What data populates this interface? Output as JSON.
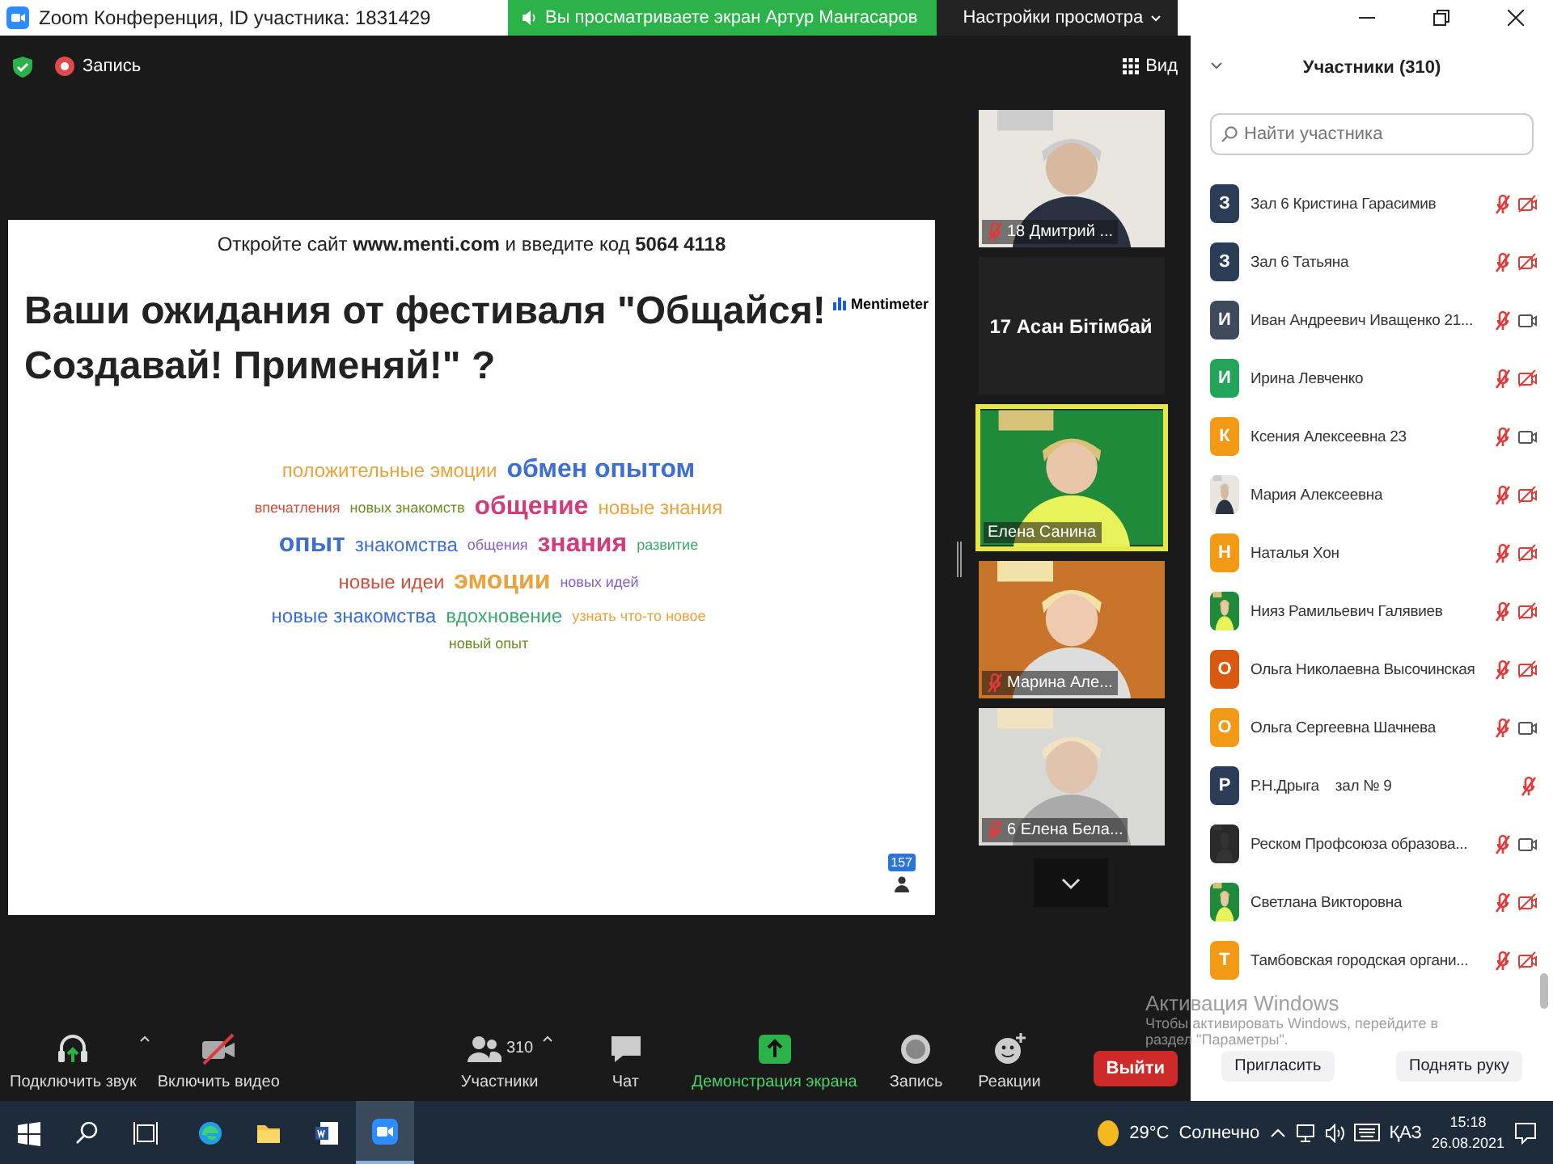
{
  "title_bar": {
    "title": "Zoom Конференция, ID участника: 1831429",
    "share_banner": "Вы просматриваете экран Артур Мангасаров",
    "view_settings": "Настройки просмотра"
  },
  "meeting_bar": {
    "record_label": "Запись",
    "view_label": "Вид"
  },
  "slide": {
    "instruction": "Откройте сайт **www.menti.com** и введите код **5064 4118**",
    "title": "Ваши ожидания от фестиваля \"Общайся! Создавай! Применяй!\" ?",
    "brand": "Mentimeter",
    "responses": "157",
    "words": [
      {
        "text": "положительные эмоции",
        "color": "#e8a33d",
        "kind": "medium"
      },
      {
        "text": "обмен опытом",
        "color": "#3d6fd1",
        "kind": "large"
      },
      {
        "text": "впечатления",
        "color": "#d1503d",
        "kind": "small"
      },
      {
        "text": "новых знакомств",
        "color": "#6b8e23",
        "kind": "small"
      },
      {
        "text": "общение",
        "color": "#d13d7a",
        "kind": "large"
      },
      {
        "text": "новые знания",
        "color": "#e8a33d",
        "kind": "medium"
      },
      {
        "text": "опыт",
        "color": "#3d6fd1",
        "kind": "large"
      },
      {
        "text": "знакомства",
        "color": "#3d6fd1",
        "kind": "medium"
      },
      {
        "text": "общения",
        "color": "#8a5cc7",
        "kind": "small"
      },
      {
        "text": "знания",
        "color": "#d13d7a",
        "kind": "large"
      },
      {
        "text": "развитие",
        "color": "#3da86f",
        "kind": "small"
      },
      {
        "text": "новые идеи",
        "color": "#d1503d",
        "kind": "medium"
      },
      {
        "text": "эмоции",
        "color": "#e8a33d",
        "kind": "large"
      },
      {
        "text": "новых идей",
        "color": "#8a5cc7",
        "kind": "small"
      },
      {
        "text": "новые знакомства",
        "color": "#3d6fd1",
        "kind": "medium"
      },
      {
        "text": "вдохновение",
        "color": "#3da86f",
        "kind": "medium"
      },
      {
        "text": "узнать что-то новое",
        "color": "#e8a33d",
        "kind": "small"
      },
      {
        "text": "новый опыт",
        "color": "#6b8e23",
        "kind": "small"
      }
    ]
  },
  "videos": [
    {
      "name": "18 Дмитрий ...",
      "kind": "video",
      "muted": true,
      "speaking": false
    },
    {
      "name": "17 Асан Бітімбай",
      "kind": "name_only",
      "muted": false,
      "speaking": false
    },
    {
      "name": "Елена Санина",
      "kind": "video",
      "muted": false,
      "speaking": true
    },
    {
      "name": "Марина Але...",
      "kind": "video",
      "muted": true,
      "speaking": false
    },
    {
      "name": "6 Елена Бела...",
      "kind": "video",
      "muted": true,
      "speaking": false
    }
  ],
  "toolbar": {
    "items": [
      {
        "label": "Подключить звук",
        "kind": "audio",
        "caret": true
      },
      {
        "label": "Включить видео",
        "kind": "video",
        "caret": false
      },
      {
        "label": "Участники",
        "kind": "participants",
        "caret": true,
        "count": "310"
      },
      {
        "label": "Чат",
        "kind": "chat",
        "caret": false
      },
      {
        "label": "Демонстрация экрана",
        "kind": "share",
        "caret": false
      },
      {
        "label": "Запись",
        "kind": "record",
        "caret": false
      },
      {
        "label": "Реакции",
        "kind": "reactions",
        "caret": false
      }
    ],
    "leave": "Выйти"
  },
  "participants": {
    "title": "Участники (310)",
    "search_placeholder": "Найти участника",
    "items": [
      {
        "name": "Зал 6 Кристина Гарасимив",
        "kind": "letter",
        "initial": "З",
        "color": "#2c3e57",
        "mic_muted": true,
        "video_shown": true,
        "video_muted": true
      },
      {
        "name": "Зал 6 Татьяна",
        "kind": "letter",
        "initial": "З",
        "color": "#2c3e57",
        "mic_muted": true,
        "video_shown": true,
        "video_muted": true
      },
      {
        "name": "Иван Андреевич Иващенко 21...",
        "kind": "letter",
        "initial": "И",
        "color": "#3d4b5c",
        "mic_muted": true,
        "video_shown": true,
        "video_muted": false
      },
      {
        "name": "Ирина Левченко",
        "kind": "letter",
        "initial": "И",
        "color": "#22a55b",
        "mic_muted": true,
        "video_shown": true,
        "video_muted": true
      },
      {
        "name": "Ксения Алексеевна 23",
        "kind": "letter",
        "initial": "К",
        "color": "#f29a16",
        "mic_muted": true,
        "video_shown": true,
        "video_muted": false
      },
      {
        "name": "Мария Алексеевна",
        "mic_muted": true,
        "video_shown": true,
        "video_muted": true
      },
      {
        "name": "Наталья Хон",
        "kind": "letter",
        "initial": "Н",
        "color": "#f29a16",
        "mic_muted": true,
        "video_shown": true,
        "video_muted": true
      },
      {
        "name": "Нияз Рамильевич Галявиев",
        "mic_muted": true,
        "video_shown": true,
        "video_muted": true
      },
      {
        "name": "Ольга Николаевна Высочинская",
        "kind": "letter",
        "initial": "О",
        "color": "#d9590f",
        "mic_muted": true,
        "video_shown": true,
        "video_muted": true
      },
      {
        "name": "Ольга Сергеевна Шачнева",
        "kind": "letter",
        "initial": "О",
        "color": "#f29a16",
        "mic_muted": true,
        "video_shown": true,
        "video_muted": false
      },
      {
        "name": "Р.Н.Дрыга    зал № 9",
        "kind": "letter",
        "initial": "Р",
        "color": "#2c3e57",
        "mic_muted": true,
        "video_shown": false
      },
      {
        "name": "Реском Профсоюза образова...",
        "mic_muted": true,
        "video_shown": true,
        "video_muted": false
      },
      {
        "name": "Светлана Викторовна",
        "mic_muted": true,
        "video_shown": true,
        "video_muted": true
      },
      {
        "name": "Тамбовская городская органи...",
        "kind": "letter",
        "initial": "Т",
        "color": "#f29a16",
        "mic_muted": true,
        "video_shown": true,
        "video_muted": true
      }
    ],
    "buttons": [
      "Пригласить",
      "Поднять руку"
    ]
  },
  "os_notice": {
    "title": "Активация Windows",
    "lines": [
      "Чтобы активировать Windows, перейдите в",
      "раздел \"Параметры\"."
    ]
  },
  "taskbar": {
    "apps": [
      {
        "kind": "start",
        "selected": false
      },
      {
        "kind": "search",
        "selected": false
      },
      {
        "kind": "taskview",
        "selected": false
      },
      {
        "kind": "edge",
        "selected": false
      },
      {
        "kind": "explorer",
        "selected": false
      },
      {
        "kind": "word",
        "selected": false
      },
      {
        "kind": "zoom",
        "selected": true
      }
    ],
    "temperature": "29°C",
    "weather": "Солнечно",
    "language": "ҚАЗ",
    "time": "15:18",
    "date": "26.08.2021"
  }
}
